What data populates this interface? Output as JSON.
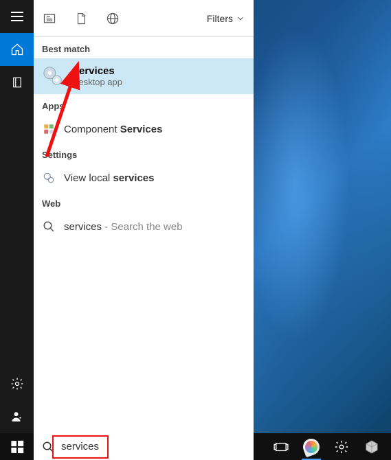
{
  "sections": {
    "best_match": "Best match",
    "apps": "Apps",
    "settings": "Settings",
    "web": "Web"
  },
  "filters_label": "Filters",
  "results": {
    "best": {
      "title": "Services",
      "subtitle": "Desktop app"
    },
    "app": {
      "prefix": "Component ",
      "bold": "Services"
    },
    "setting": {
      "prefix": "View local ",
      "bold": "services"
    },
    "web": {
      "term": "services",
      "hint": " - Search the web"
    }
  },
  "search": {
    "value": "services"
  },
  "colors": {
    "accent": "#0078d7",
    "highlight": "#cce8f6",
    "annotation": "#e11"
  }
}
